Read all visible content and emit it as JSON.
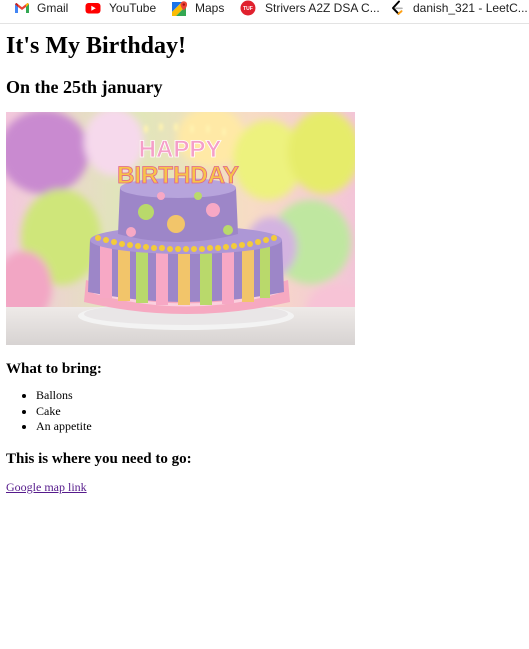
{
  "bookmarks": [
    {
      "label": "Gmail",
      "icon": "gmail-icon"
    },
    {
      "label": "YouTube",
      "icon": "youtube-icon"
    },
    {
      "label": "Maps",
      "icon": "maps-icon"
    },
    {
      "label": "Strivers A2Z DSA C...",
      "icon": "takeuforward-icon"
    },
    {
      "label": "danish_321 - LeetC...",
      "icon": "leetcode-icon"
    }
  ],
  "page": {
    "title": "It's My Birthday!",
    "subtitle": "On the 25th january",
    "bring_heading": "What to bring:",
    "bring_items": [
      "Ballons",
      "Cake",
      "An appetite"
    ],
    "where_heading": "This is where you need to go:",
    "map_link_text": "Google map link"
  },
  "image": {
    "cake_topper_text_line1": "HAPPY",
    "cake_topper_text_line2": "BIRTHDAY"
  },
  "colors": {
    "visited_link": "#551a8b",
    "youtube_red": "#ff0000",
    "tuf_red": "#e0212e",
    "cake_purple": "#9d86c8",
    "balloon_yellow": "#ebf07a"
  }
}
